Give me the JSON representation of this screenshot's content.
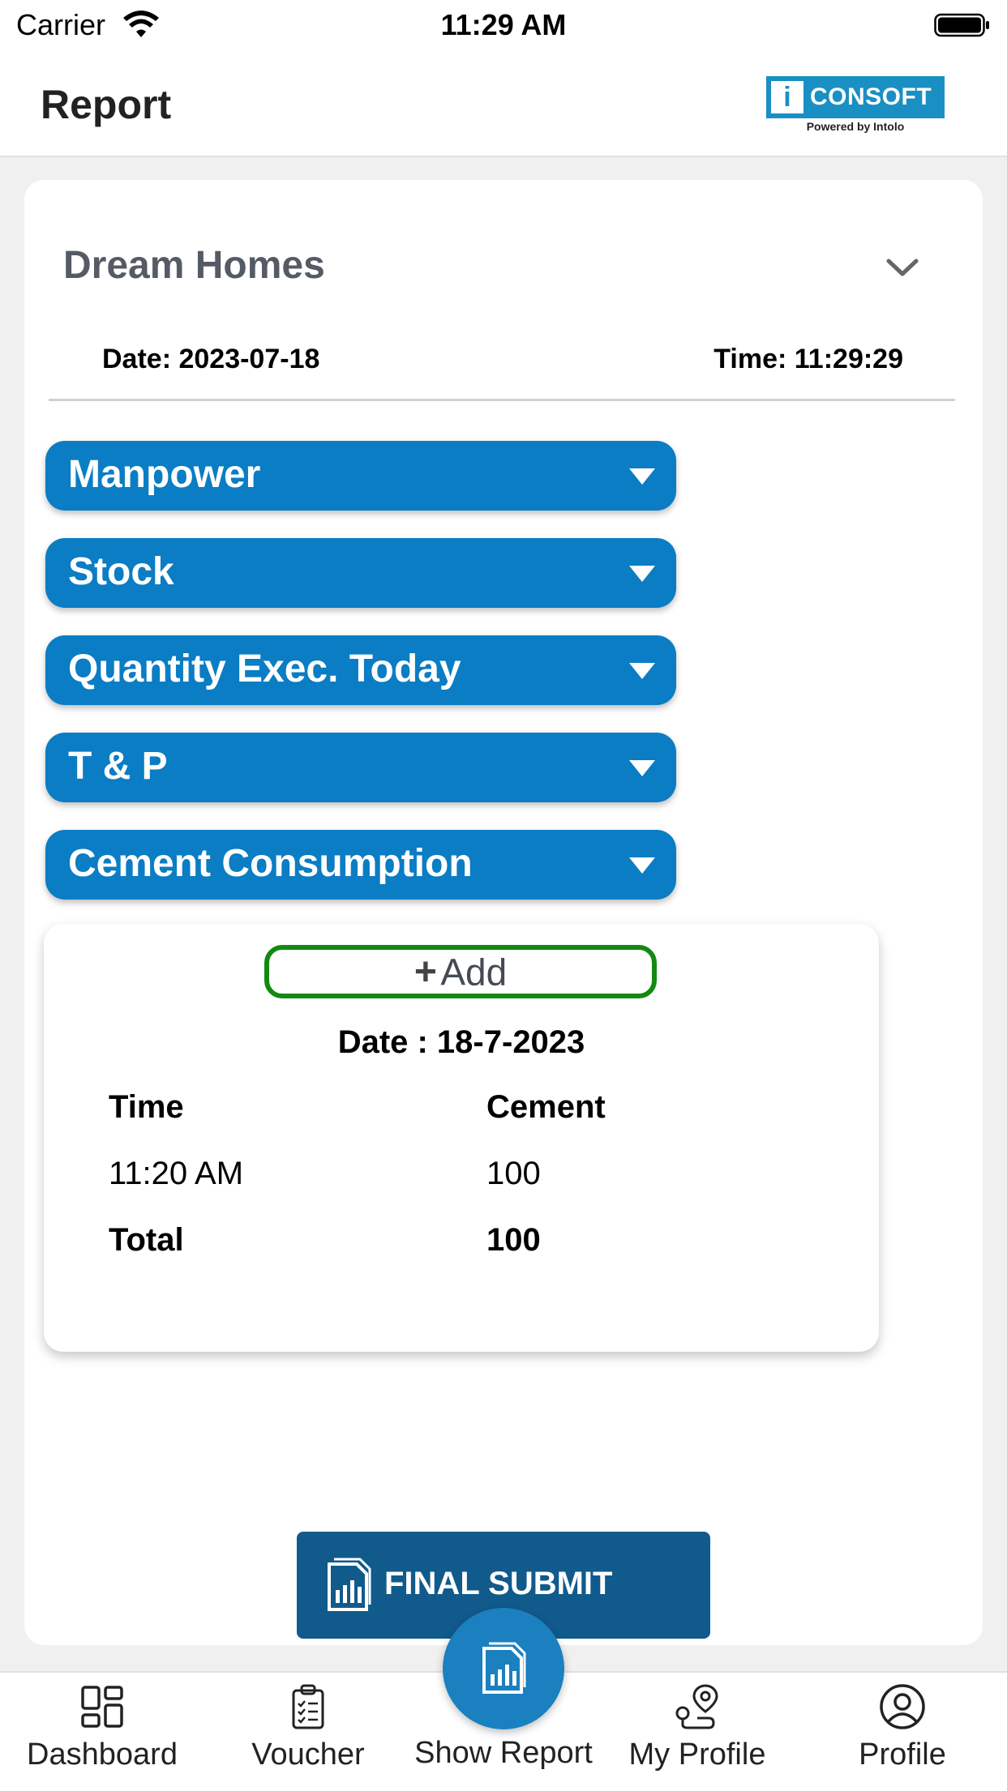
{
  "status_bar": {
    "carrier": "Carrier",
    "time": "11:29 AM"
  },
  "header": {
    "title": "Report",
    "logo": {
      "brand": "CONSOFT",
      "mark": "i",
      "tagline": "Powered by Intolo",
      "color": "#1a8fc4"
    }
  },
  "project": {
    "name": "Dream Homes",
    "date": "Date: 2023-07-18",
    "time": "Time: 11:29:29"
  },
  "sections": [
    {
      "label": "Manpower"
    },
    {
      "label": "Stock"
    },
    {
      "label": "Quantity Exec. Today"
    },
    {
      "label": "T & P"
    },
    {
      "label": "Cement Consumption"
    }
  ],
  "cement_panel": {
    "add_icon": "+",
    "add_label": "Add",
    "date": "Date : 18-7-2023",
    "columns": [
      "Time",
      "Cement"
    ],
    "rows": [
      [
        "11:20 AM",
        "100"
      ]
    ],
    "total": [
      "Total",
      "100"
    ]
  },
  "final_submit": {
    "label": "FINAL SUBMIT",
    "icon": "report-icon"
  },
  "tabbar": {
    "items": [
      {
        "label": "Dashboard",
        "icon": "dashboard-icon"
      },
      {
        "label": "Voucher",
        "icon": "clipboard-icon"
      },
      {
        "label": "Show Report",
        "icon": "report-icon",
        "active": true
      },
      {
        "label": "My Profile",
        "icon": "location-route-icon"
      },
      {
        "label": "Profile",
        "icon": "user-icon"
      }
    ]
  },
  "colors": {
    "accordion": "#0a7dc4",
    "submit": "#115a8c",
    "add_border": "#128a12",
    "fab": "#1a80c0"
  }
}
